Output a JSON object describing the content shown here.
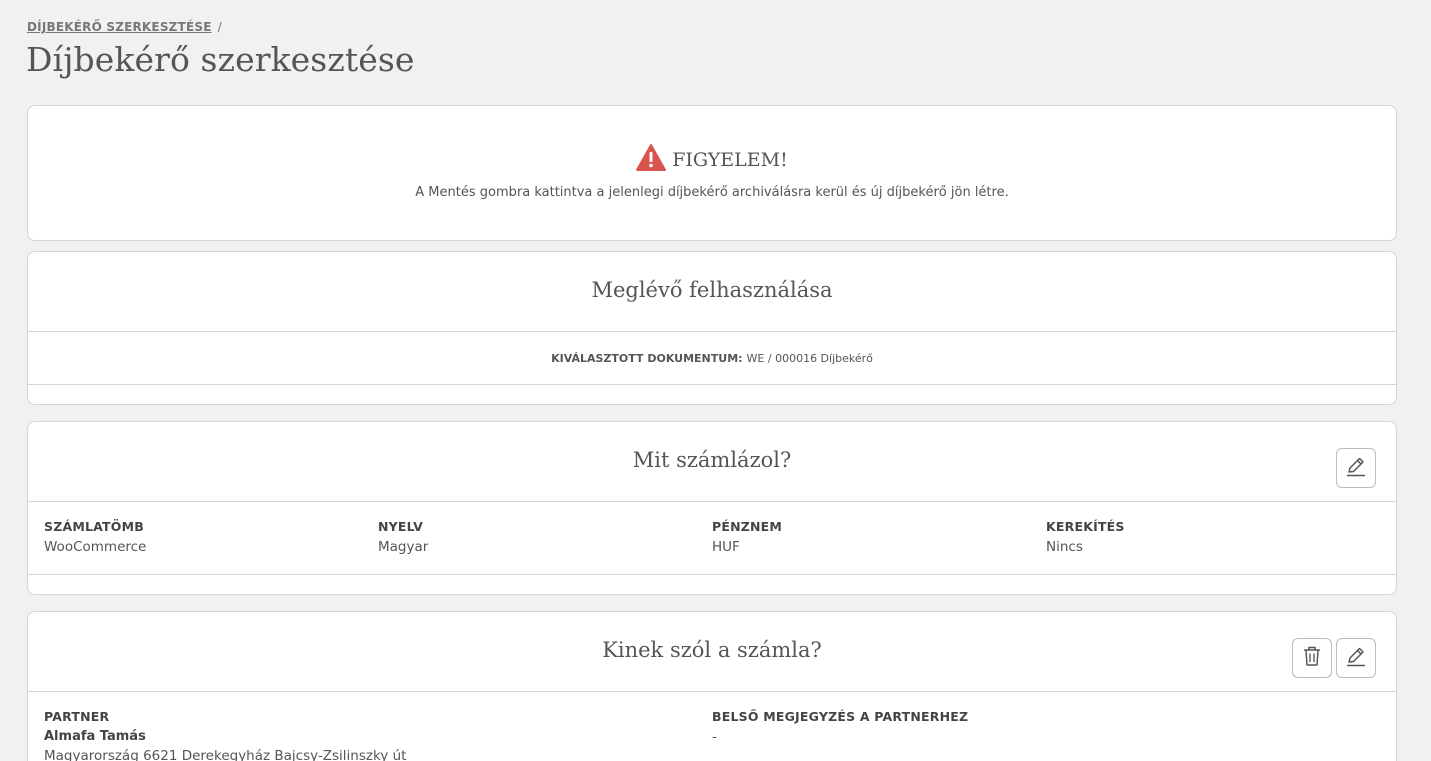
{
  "breadcrumb": {
    "item": "DÍJBEKÉRŐ SZERKESZTÉSE",
    "separator": "/"
  },
  "page_title": "Díjbekérő szerkesztése",
  "warning": {
    "icon": "warning-triangle-icon",
    "title": "FIGYELEM!",
    "text": "A Mentés gombra kattintva a jelenlegi díjbekérő archiválásra kerül és új díjbekérő jön létre.",
    "color": "#d9534f"
  },
  "existing": {
    "title": "Meglévő felhasználása",
    "selected_label": "KIVÁLASZTOTT DOKUMENTUM:",
    "selected_value": "WE / 000016 Díjbekérő"
  },
  "what": {
    "title": "Mit számlázol?",
    "edit_icon": "pencil-icon",
    "fields": [
      {
        "label": "SZÁMLATÖMB",
        "value": "WooCommerce"
      },
      {
        "label": "NYELV",
        "value": "Magyar"
      },
      {
        "label": "PÉNZNEM",
        "value": "HUF"
      },
      {
        "label": "KEREKÍTÉS",
        "value": "Nincs"
      }
    ]
  },
  "who": {
    "title": "Kinek szól a számla?",
    "delete_icon": "trash-icon",
    "edit_icon": "pencil-icon",
    "partner_label": "PARTNER",
    "partner_name": "Almafa Tamás",
    "partner_address": "Magyarország 6621 Derekegyház Bajcsy-Zsilinszky út",
    "note_label": "BELSŐ MEGJEGYZÉS A PARTNERHEZ",
    "note_value": "-"
  }
}
